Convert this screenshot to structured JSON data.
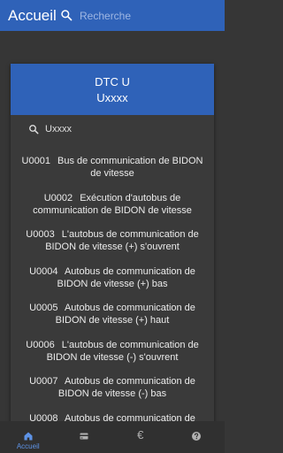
{
  "appbar": {
    "title": "Accueil",
    "search_placeholder": "Recherche"
  },
  "dialog": {
    "title": "DTC U",
    "subtitle": "Uxxxx",
    "search_value": "Uxxxx",
    "items": [
      {
        "code": "U0001",
        "description": "Bus de communication de BIDON de vitesse"
      },
      {
        "code": "U0002",
        "description": "Exécution d'autobus de communication de BIDON de vitesse"
      },
      {
        "code": "U0003",
        "description": "L'autobus de communication de BIDON de vitesse (+) s'ouvrent"
      },
      {
        "code": "U0004",
        "description": "Autobus de communication de BIDON de vitesse (+) bas"
      },
      {
        "code": "U0005",
        "description": "Autobus de communication de BIDON de vitesse (+) haut"
      },
      {
        "code": "U0006",
        "description": "L'autobus de communication de BIDON de vitesse (-) s'ouvrent"
      },
      {
        "code": "U0007",
        "description": "Autobus de communication de BIDON de vitesse (-) bas"
      },
      {
        "code": "U0008",
        "description": "Autobus de communication de"
      }
    ]
  },
  "bottom_nav": {
    "items": [
      {
        "label": "Accueil",
        "icon": "home-icon",
        "active": true
      },
      {
        "label": "",
        "icon": "car-icon",
        "active": false
      },
      {
        "label": "",
        "icon": "euro-icon",
        "glyph": "€",
        "active": false
      },
      {
        "label": "",
        "icon": "help-icon",
        "active": false
      }
    ]
  },
  "colors": {
    "primary": "#2f62b8",
    "background": "#363636",
    "dialog_background": "#3a3a3a",
    "nav_background": "#303030",
    "active_nav": "#5e93e6"
  }
}
